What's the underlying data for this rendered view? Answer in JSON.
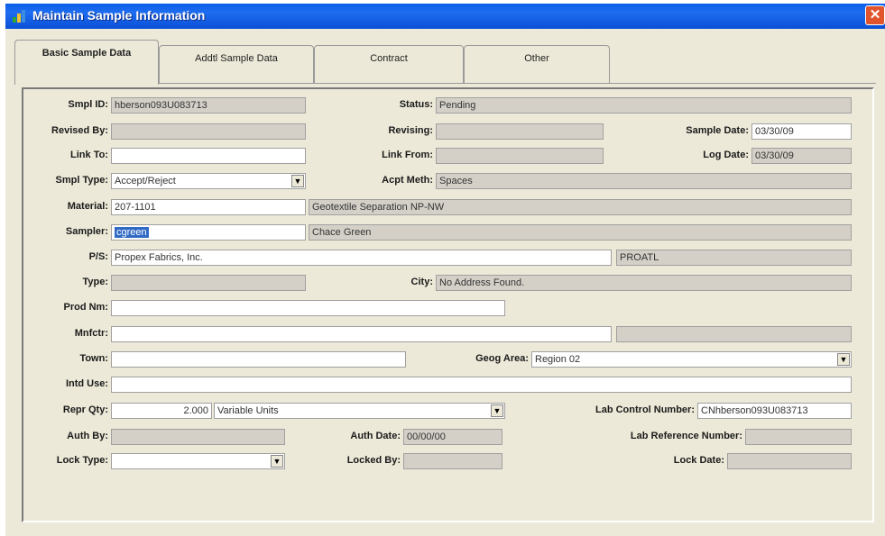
{
  "window": {
    "title": "Maintain Sample Information"
  },
  "tabs": [
    {
      "label": "Basic Sample Data",
      "active": true
    },
    {
      "label": "Addtl Sample Data"
    },
    {
      "label": "Contract"
    },
    {
      "label": "Other"
    }
  ],
  "form": {
    "smpl_id": {
      "label": "Smpl ID:",
      "value": "hberson093U083713"
    },
    "status": {
      "label": "Status:",
      "value": "Pending"
    },
    "revised_by": {
      "label": "Revised By:",
      "value": ""
    },
    "revising": {
      "label": "Revising:",
      "value": ""
    },
    "sample_date": {
      "label": "Sample Date:",
      "value": "03/30/09"
    },
    "link_to": {
      "label": "Link To:",
      "value": ""
    },
    "link_from": {
      "label": "Link From:",
      "value": ""
    },
    "log_date": {
      "label": "Log Date:",
      "value": "03/30/09"
    },
    "smpl_type": {
      "label": "Smpl Type:",
      "value": "Accept/Reject"
    },
    "acpt_meth": {
      "label": "Acpt Meth:",
      "value": "Spaces"
    },
    "material": {
      "label": "Material:",
      "value": "207-1101",
      "description": "Geotextile Separation NP-NW"
    },
    "sampler": {
      "label": "Sampler:",
      "value": "cgreen",
      "name": "Chace Green"
    },
    "ps": {
      "label": "P/S:",
      "value": "Propex Fabrics, Inc.",
      "code": "PROATL"
    },
    "type": {
      "label": "Type:",
      "value": ""
    },
    "city": {
      "label": "City:",
      "value": "No Address Found."
    },
    "prod_nm": {
      "label": "Prod Nm:",
      "value": ""
    },
    "mnfctr": {
      "label": "Mnfctr:",
      "value": "",
      "extra": ""
    },
    "town": {
      "label": "Town:",
      "value": ""
    },
    "geog_area": {
      "label": "Geog Area:",
      "value": "Region 02"
    },
    "intd_use": {
      "label": "Intd Use:",
      "value": ""
    },
    "repr_qty": {
      "label": "Repr Qty:",
      "value": "2.000",
      "units": "Variable Units"
    },
    "lab_control_number": {
      "label": "Lab Control Number:",
      "value": "CNhberson093U083713"
    },
    "auth_by": {
      "label": "Auth By:",
      "value": ""
    },
    "auth_date": {
      "label": "Auth Date:",
      "value": "00/00/00"
    },
    "lab_reference_number": {
      "label": "Lab Reference Number:",
      "value": ""
    },
    "lock_type": {
      "label": "Lock Type:",
      "value": ""
    },
    "locked_by": {
      "label": "Locked By:",
      "value": ""
    },
    "lock_date": {
      "label": "Lock Date:",
      "value": ""
    }
  },
  "icons": {
    "app": "app-icon",
    "close": "close-icon",
    "dropdown": "chevron-down-icon"
  },
  "colors": {
    "titlebar": "#0a5ee8",
    "window_bg": "#ece9d8",
    "readonly_field": "#d4d0c8",
    "selection": "#316ac5",
    "close": "#e2542b"
  }
}
